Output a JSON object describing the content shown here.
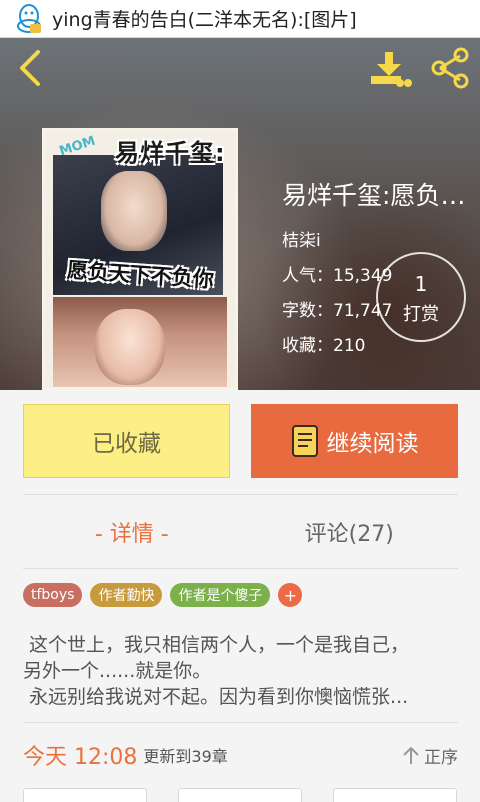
{
  "notification": {
    "text": "ying青春的告白(二洋本无名):[图片]",
    "icon": "qq-penguin-icon"
  },
  "header": {
    "back_icon": "chevron-left-icon",
    "download_icon": "download-icon",
    "share_icon": "share-icon"
  },
  "book": {
    "cover_title": "易烊千玺:",
    "cover_subtitle": "愿负天下不负你",
    "cover_badge": "MOM",
    "title": "易烊千玺:愿负天下不负你",
    "author": "桔柒i",
    "popularity": "人气：15,349",
    "word_count": "字数：71,747",
    "collections": "收藏：210"
  },
  "reward": {
    "count": "1",
    "label": "打赏"
  },
  "actions": {
    "favorited_label": "已收藏",
    "read_label": "继续阅读",
    "read_icon": "book-icon"
  },
  "tabs": [
    {
      "label": "- 详情 -",
      "active": true
    },
    {
      "label": "评论(27)",
      "active": false
    }
  ],
  "tags": [
    {
      "label": "tfboys",
      "color": "#c86f62"
    },
    {
      "label": "作者勤快",
      "color": "#c79a3c"
    },
    {
      "label": "作者是个傻子",
      "color": "#7bb04a"
    }
  ],
  "add_tag_label": "+",
  "description": {
    "line1": " 这个世上，我只相信两个人，一个是我自己，",
    "line2": "另外一个......就是你。",
    "line3": " 永远别给我说对不起。因为看到你懊恼慌张..."
  },
  "update": {
    "time": "今天 12:08",
    "chapter": "更新到39章",
    "sort_label": "正序",
    "sort_icon": "arrow-up-icon"
  },
  "colors": {
    "accent": "#e8713f",
    "favorite_bg": "#fcef85",
    "read_bg": "#e86b3f"
  }
}
